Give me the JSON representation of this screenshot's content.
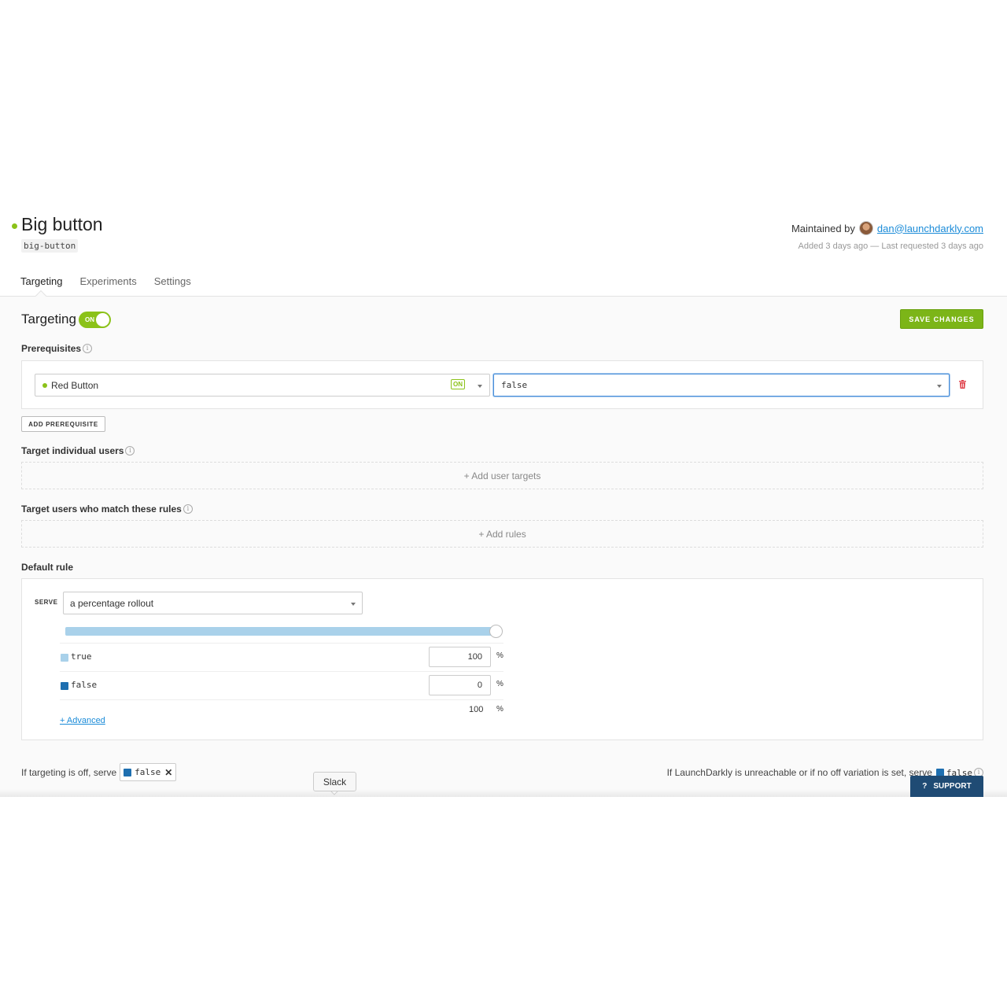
{
  "header": {
    "title": "Big button",
    "key": "big-button",
    "maintained_by_label": "Maintained by",
    "maintainer_email": "dan@launchdarkly.com",
    "meta": "Added 3 days ago — Last requested 3 days ago"
  },
  "tabs": [
    {
      "label": "Targeting"
    },
    {
      "label": "Experiments"
    },
    {
      "label": "Settings"
    }
  ],
  "targeting": {
    "title": "Targeting",
    "toggle_label": "ON",
    "toggle_on": true,
    "save_label": "SAVE CHANGES"
  },
  "prerequisites": {
    "label": "Prerequisites",
    "flag_name": "Red Button",
    "flag_status": "ON",
    "variation": "false",
    "add_label": "ADD PREREQUISITE"
  },
  "individual": {
    "label": "Target individual users",
    "add_label": "+ Add user targets"
  },
  "rules": {
    "label": "Target users who match these rules",
    "add_label": "+ Add rules"
  },
  "default_rule": {
    "label": "Default rule",
    "serve_label": "SERVE",
    "serve_value": "a percentage rollout",
    "rollout": [
      {
        "name": "true",
        "value": "100",
        "color": "#a9d1ea",
        "fraction": 1.0
      },
      {
        "name": "false",
        "value": "0",
        "color": "#1e6fb0",
        "fraction": 0.0
      }
    ],
    "percent_sign": "%",
    "total": "100",
    "advanced_label": "+ Advanced"
  },
  "footer": {
    "off_label": "If targeting is off, serve",
    "off_value": "false",
    "unreachable_label": "If LaunchDarkly is unreachable or if no off variation is set, serve",
    "unreachable_value": "false",
    "tooltip": "Slack",
    "support_label": "SUPPORT",
    "support_icon": "?"
  },
  "colors": {
    "accent": "#8bc219",
    "link": "#1a8bd8",
    "support_bg": "#1f4b74"
  }
}
